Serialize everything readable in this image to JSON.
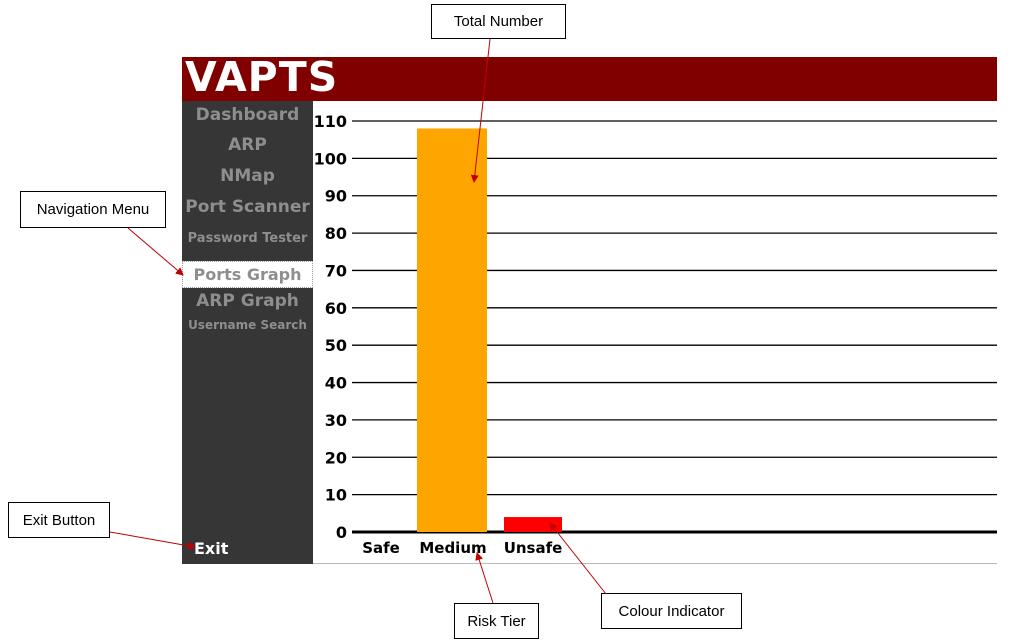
{
  "annotations": {
    "total_number": "Total Number",
    "navigation_menu": "Navigation Menu",
    "exit_button": "Exit Button",
    "risk_tier": "Risk Tier",
    "colour_indicator": "Colour Indicator"
  },
  "app": {
    "logo": "VAPTS",
    "header_color": "#800000",
    "sidebar_color": "#363636"
  },
  "sidebar": {
    "items": [
      {
        "label": "Dashboard"
      },
      {
        "label": "ARP"
      },
      {
        "label": "NMap"
      },
      {
        "label": "Port Scanner"
      },
      {
        "label": "Password Tester"
      },
      {
        "label": "Ports Graph",
        "active": true
      },
      {
        "label": "ARP Graph"
      },
      {
        "label": "Username Search"
      }
    ],
    "exit_label": "Exit"
  },
  "chart_data": {
    "type": "bar",
    "categories": [
      "Safe",
      "Medium",
      "Unsafe"
    ],
    "values": [
      0,
      108,
      4
    ],
    "colors": [
      "#ffa500",
      "#ffa500",
      "#ff0000"
    ],
    "ylim": [
      0,
      110
    ],
    "yticks": [
      0,
      10,
      20,
      30,
      40,
      50,
      60,
      70,
      80,
      90,
      100,
      110
    ],
    "grid": true,
    "title": "",
    "xlabel": "",
    "ylabel": ""
  }
}
